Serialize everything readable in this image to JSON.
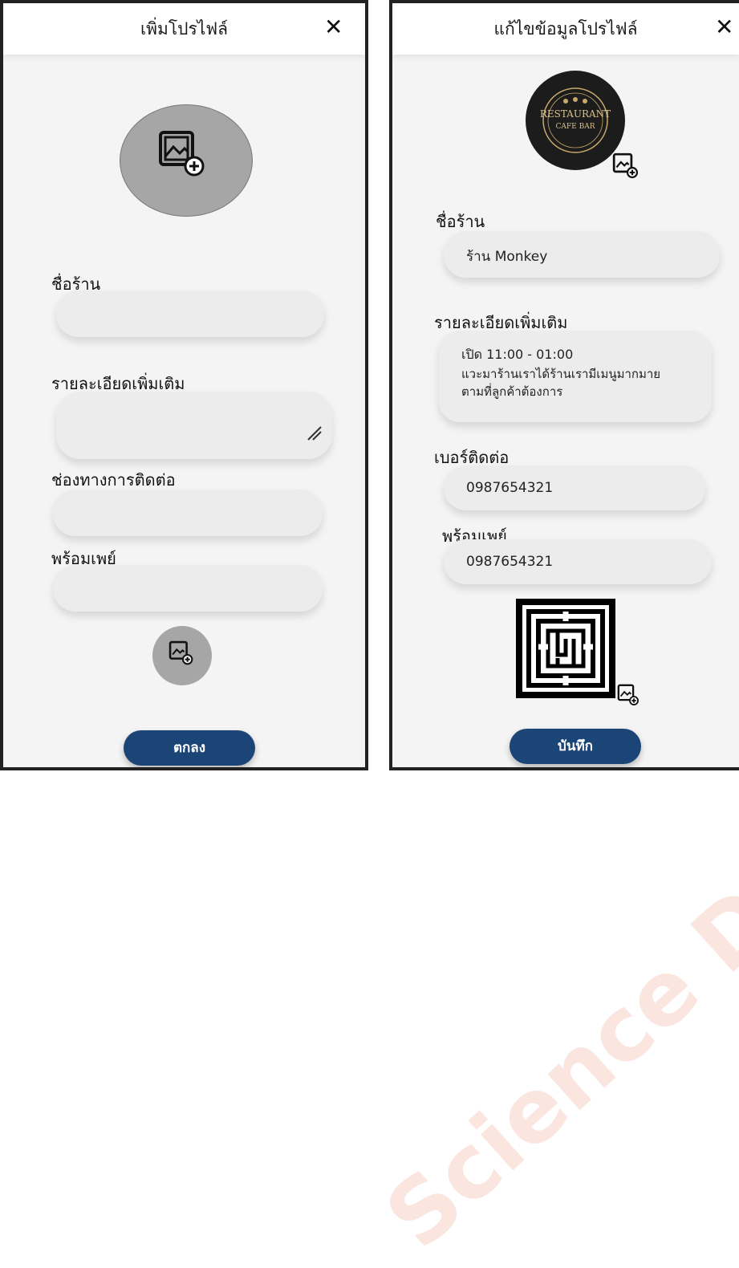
{
  "left": {
    "title": "เพิ่มโปรไฟล์",
    "close_icon": "close-icon",
    "shop_name_label": "ชื่อร้าน",
    "details_label": "รายละเอียดเพิ่มเติม",
    "contact_label": "ช่องทางการติดต่อ",
    "promptpay_label": "พร้อมเพย์",
    "confirm_button": "ตกลง"
  },
  "right": {
    "title": "แก้ไขข้อมูลโปรไฟล์",
    "close_icon": "close-icon",
    "logo_text_main": "RESTAURANT",
    "logo_text_sub": "CAFE BAR",
    "shop_name_label": "ชื่อร้าน",
    "shop_name_value": "ร้าน  Monkey",
    "details_label": "รายละเอียดเพิ่มเติม",
    "details_line1": "เปิด 11:00 - 01:00",
    "details_line2": "แวะมาร้านเราได้ร้านเรามีเมนูมากมาย",
    "details_line3": "ตามที่ลูกค้าต้องการ",
    "phone_label": "เบอร์ติดต่อ",
    "phone_value": "0987654321",
    "promptpay_label": "พร้อมเพย์",
    "promptpay_value": "0987654321",
    "save_button": "บันทึก"
  },
  "watermark": "Science Department, Mahasarakham University",
  "colors": {
    "button": "#1b4577",
    "field": "#ececec",
    "avatar": "#a6a6a6"
  }
}
